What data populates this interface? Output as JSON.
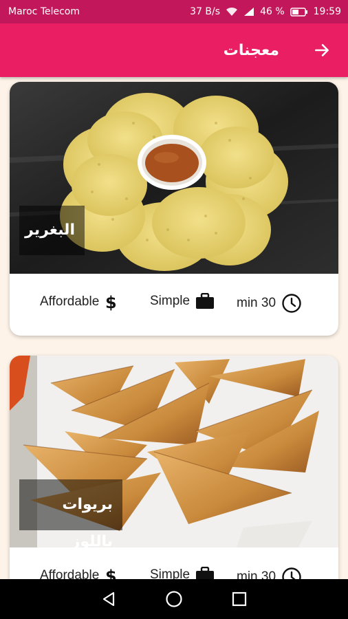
{
  "status_bar": {
    "carrier": "Maroc Telecom",
    "speed": "37 B/s",
    "battery": "46 %",
    "time": "19:59"
  },
  "app_bar": {
    "title": "معجنات",
    "back_icon": "arrow-forward-icon"
  },
  "recipes": [
    {
      "title": "البغرير",
      "duration": "min 30",
      "complexity": "Simple",
      "affordability": "Affordable"
    },
    {
      "title": "بريوات باللوز",
      "duration": "min 30",
      "complexity": "Simple",
      "affordability": "Affordable"
    }
  ],
  "nav_bar": {
    "back": "back-triangle-icon",
    "home": "home-circle-icon",
    "recents": "recents-square-icon"
  },
  "colors": {
    "status_bar": "#c2185b",
    "app_bar": "#e91e63",
    "background": "#fdf3e8"
  }
}
